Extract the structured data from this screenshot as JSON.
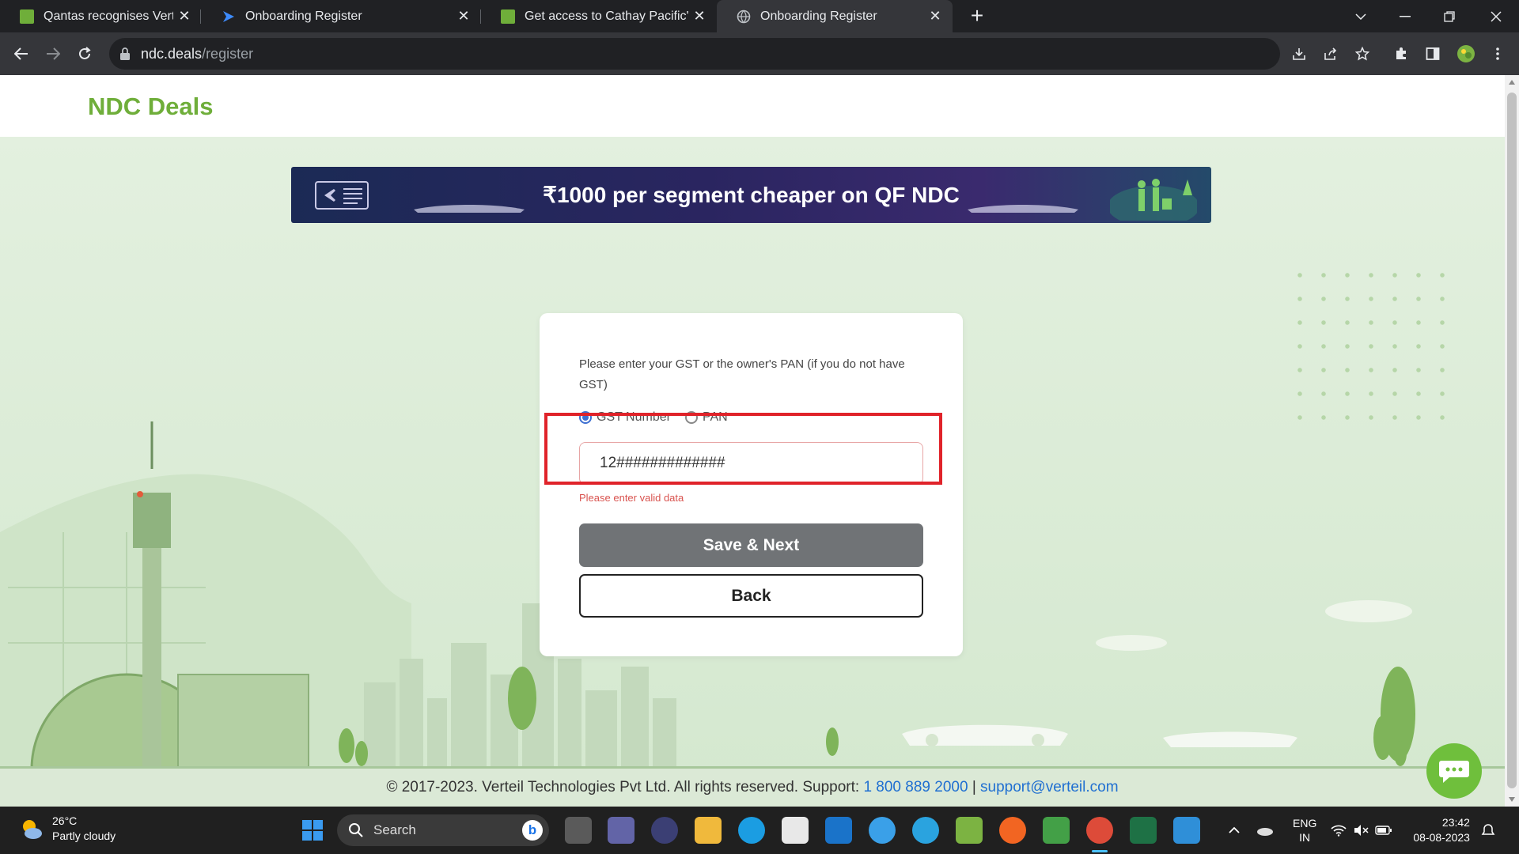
{
  "browser": {
    "tabs": [
      {
        "title": "Qantas recognises Verteil as a Te",
        "active": false
      },
      {
        "title": "Onboarding Register",
        "active": false
      },
      {
        "title": "Get access to Cathay Pacific's ND",
        "active": false
      },
      {
        "title": "Onboarding Register",
        "active": true
      }
    ],
    "close_glyph": "✕",
    "new_tab_glyph": "+",
    "url_host": "ndc.deals",
    "url_path": "/register"
  },
  "page": {
    "logo": "NDC Deals",
    "banner_text": "₹1000 per segment cheaper on QF NDC",
    "form": {
      "prompt": "Please enter your GST or the owner's PAN (if you do not have GST)",
      "radio_gst_label": "GST Number",
      "radio_pan_label": "PAN",
      "selected": "GST Number",
      "input_value": "12#############",
      "error_text": "Please enter valid data",
      "save_label": "Save & Next",
      "back_label": "Back"
    },
    "footer": {
      "copyright": "© 2017-2023. Verteil Technologies Pvt Ltd. All rights reserved. Support:",
      "phone": "1 800 889 2000",
      "separator": "|",
      "email": "support@verteil.com"
    }
  },
  "taskbar": {
    "temperature": "26°C",
    "weather": "Partly cloudy",
    "search_label": "Search",
    "language": "ENG",
    "region": "IN",
    "time": "23:42",
    "date": "08-08-2023"
  },
  "colors": {
    "brand_green": "#6fae3a",
    "highlight_red": "#e0232a",
    "link_blue": "#1f6fd1"
  }
}
